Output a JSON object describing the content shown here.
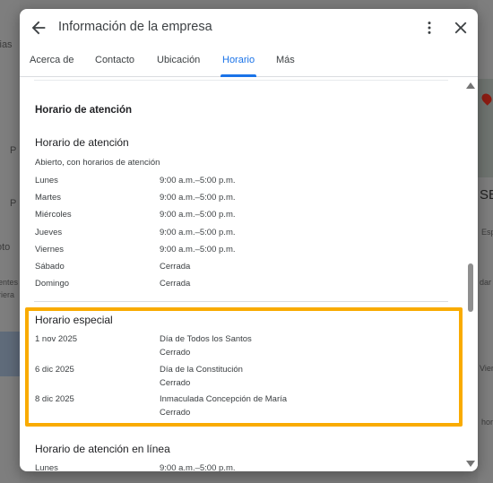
{
  "background": {
    "left_fragments": [
      "cias",
      "P",
      "P",
      "oto",
      "entes",
      "riera"
    ],
    "right_fragments": [
      "SEC",
      "Esp",
      "dar",
      "Vier",
      "hor"
    ]
  },
  "dialog": {
    "title": "Información de la empresa",
    "icons": {
      "back": "arrow-back-icon",
      "more": "more-vert-icon",
      "close": "close-icon"
    }
  },
  "tabs": [
    {
      "label": "Acerca de",
      "active": false
    },
    {
      "label": "Contacto",
      "active": false
    },
    {
      "label": "Ubicación",
      "active": false
    },
    {
      "label": "Horario",
      "active": true
    },
    {
      "label": "Más",
      "active": false
    }
  ],
  "hours": {
    "section_title": "Horario de atención",
    "regular_title": "Horario de atención",
    "status_note": "Abierto, con horarios de atención",
    "days": [
      {
        "day": "Lunes",
        "hours": "9:00 a.m.–5:00 p.m."
      },
      {
        "day": "Martes",
        "hours": "9:00 a.m.–5:00 p.m."
      },
      {
        "day": "Miércoles",
        "hours": "9:00 a.m.–5:00 p.m."
      },
      {
        "day": "Jueves",
        "hours": "9:00 a.m.–5:00 p.m."
      },
      {
        "day": "Viernes",
        "hours": "9:00 a.m.–5:00 p.m."
      },
      {
        "day": "Sábado",
        "hours": "Cerrada"
      },
      {
        "day": "Domingo",
        "hours": "Cerrada"
      }
    ]
  },
  "special_hours": {
    "title": "Horario especial",
    "entries": [
      {
        "date": "1 nov 2025",
        "name": "Día de Todos los Santos",
        "status": "Cerrado"
      },
      {
        "date": "6 dic 2025",
        "name": "Día de la Constitución",
        "status": "Cerrado"
      },
      {
        "date": "8 dic 2025",
        "name": "Inmaculada Concepción de María",
        "status": "Cerrado"
      }
    ]
  },
  "online_hours": {
    "title": "Horario de atención en línea",
    "first_row": {
      "day": "Lunes",
      "hours": "9:00 a.m.–5:00 p.m."
    }
  },
  "colors": {
    "accent": "#1a73e8",
    "highlight": "#f9ab00"
  }
}
